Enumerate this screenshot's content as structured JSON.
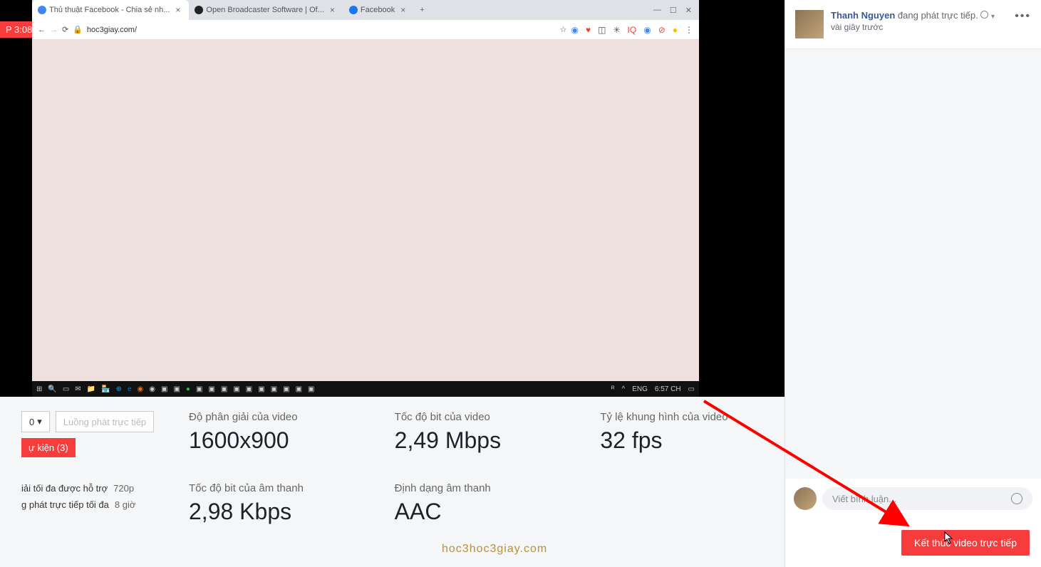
{
  "live_badge": "P 3:08",
  "browser": {
    "tabs": [
      {
        "title": "Thủ thuật Facebook - Chia sẻ nh..."
      },
      {
        "title": "Open Broadcaster Software | Of..."
      },
      {
        "title": "Facebook"
      }
    ],
    "url": "hoc3giay.com/",
    "win_min": "—",
    "win_max": "☐",
    "win_close": "✕"
  },
  "taskbar": {
    "lang": "ENG",
    "time": "6:57 CH"
  },
  "controls": {
    "dropdown_value": "0",
    "stream_label": "Luồng phát trực tiếp",
    "event_label": "ự kiện (3)",
    "max_res_label": "iải tối đa được hỗ trợ",
    "max_res_value": "720p",
    "max_time_label": "g phát trực tiếp tối đa",
    "max_time_value": "8 giờ"
  },
  "stats": {
    "resolution_label": "Độ phân giải của video",
    "resolution_value": "1600x900",
    "bitrate_label": "Tốc độ bit của video",
    "bitrate_value": "2,49 Mbps",
    "fps_label": "Tỷ lệ khung hình của video",
    "fps_value": "32 fps",
    "audio_bitrate_label": "Tốc độ bit của âm thanh",
    "audio_bitrate_value": "2,98 Kbps",
    "audio_format_label": "Định dạng âm thanh",
    "audio_format_value": "AAC"
  },
  "sidebar": {
    "author": "Thanh Nguyen",
    "status": "đang phát trực tiếp.",
    "timestamp": "vài giây trước",
    "comment_placeholder": "Viết bình luận...",
    "end_button": "Kết thúc video trực tiếp"
  },
  "watermark": "hoc3hoc3giay.com"
}
